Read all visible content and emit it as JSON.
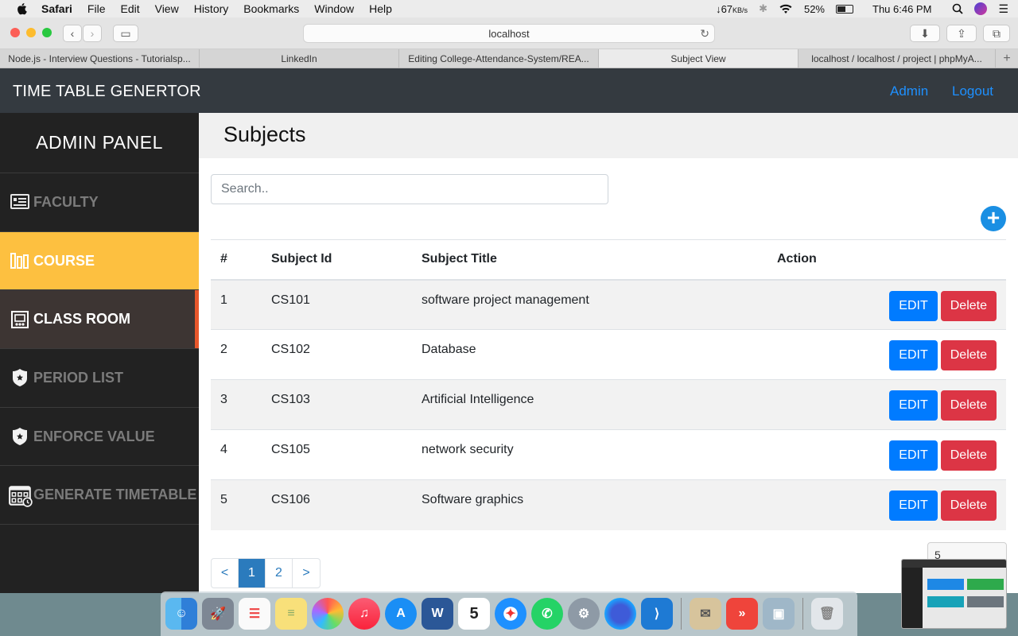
{
  "menubar": {
    "app": "Safari",
    "items": [
      "File",
      "Edit",
      "View",
      "History",
      "Bookmarks",
      "Window",
      "Help"
    ],
    "net_speed": "↓67",
    "net_unit": "KB/s",
    "battery": "52%",
    "clock": "Thu 6:46 PM"
  },
  "browser": {
    "url": "localhost",
    "tabs": [
      "Node.js - Interview Questions - Tutorialsp...",
      "LinkedIn",
      "Editing College-Attendance-System/REA...",
      "Subject View",
      "localhost / localhost / project | phpMyA..."
    ],
    "active_tab": 3
  },
  "app": {
    "brand": "TIME TABLE GENERTOR",
    "nav_admin": "Admin",
    "nav_logout": "Logout"
  },
  "sidebar": {
    "title": "ADMIN PANEL",
    "items": [
      {
        "label": "FACULTY",
        "icon": "faculty-icon"
      },
      {
        "label": "COURSE",
        "icon": "course-icon"
      },
      {
        "label": "CLASS ROOM",
        "icon": "classroom-icon"
      },
      {
        "label": "PERIOD LIST",
        "icon": "badge-icon"
      },
      {
        "label": "ENFORCE VALUE",
        "icon": "badge-icon"
      },
      {
        "label": "GENERATE TIMETABLE",
        "icon": "calendar-icon"
      }
    ],
    "active_index": 1,
    "hover_index": 2
  },
  "main": {
    "title": "Subjects",
    "search_placeholder": "Search..",
    "columns": [
      "#",
      "Subject Id",
      "Subject Title",
      "Action"
    ],
    "rows": [
      {
        "num": "1",
        "id": "CS101",
        "title": "software project management"
      },
      {
        "num": "2",
        "id": "CS102",
        "title": "Database"
      },
      {
        "num": "3",
        "id": "CS103",
        "title": "Artificial Intelligence"
      },
      {
        "num": "4",
        "id": "CS105",
        "title": "network security"
      },
      {
        "num": "5",
        "id": "CS106",
        "title": "Software graphics"
      }
    ],
    "edit_label": "EDIT",
    "delete_label": "Delete",
    "pagination": {
      "prev": "<",
      "pages": [
        "1",
        "2"
      ],
      "next": ">",
      "current": "1"
    },
    "per_page_value": "5"
  },
  "colors": {
    "navbar": "#343a40",
    "sidebar": "#222222",
    "active": "#fdc040",
    "edit": "#007bff",
    "delete": "#dc3545"
  }
}
